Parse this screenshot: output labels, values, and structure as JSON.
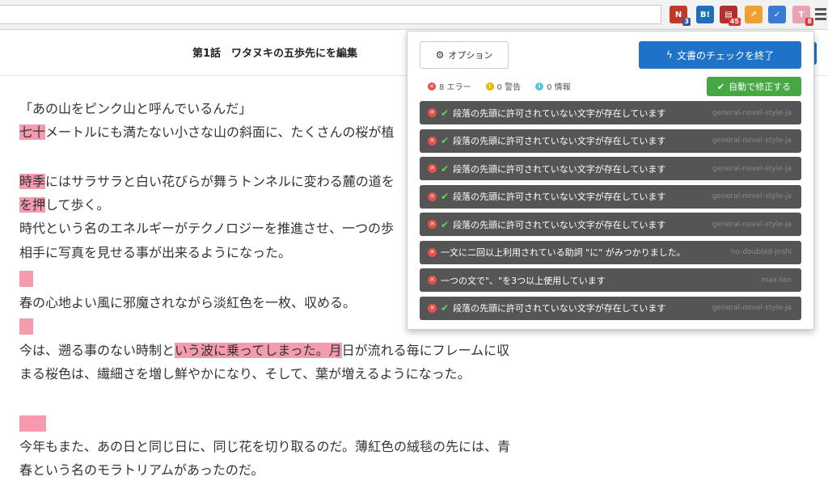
{
  "browser": {
    "extensions": [
      {
        "name": "n-extension",
        "label": "N",
        "badge": "3",
        "color": "#c0392b",
        "badge_color": "#3b5998"
      },
      {
        "name": "hatebu-extension",
        "label": "B!",
        "badge": "",
        "color": "#1d6fb8",
        "badge_color": "#888"
      },
      {
        "name": "calendar-extension",
        "label": "▤",
        "badge": "45",
        "color": "#b03030",
        "badge_color": "#d33"
      },
      {
        "name": "analytics-extension",
        "label": "↗",
        "badge": "",
        "color": "#f0a030",
        "badge_color": "#888"
      },
      {
        "name": "check-extension",
        "label": "✓",
        "badge": "",
        "color": "#3a7bd5",
        "badge_color": "#888"
      },
      {
        "name": "textlint-extension",
        "label": "T",
        "badge": "8",
        "color": "#e9a3b3",
        "badge_color": "#d33"
      }
    ]
  },
  "page": {
    "title": "第1話　ワタヌキの五歩先にを編集"
  },
  "editor": {
    "line1": "「あの山をピンク山と呼んでいるんだ」",
    "line2_hl": "七十",
    "line2_rest": "メートルにも満たない小さな山の斜面に、たくさんの桜が植",
    "line3_hl": "時季",
    "line3_rest": "にはサラサラと白い花びらが舞うトンネルに変わる麓の道を",
    "line4_hl": "を押",
    "line4_rest": "して歩く。",
    "line5": "時代という名のエネルギーがテクノロジーを推進させ、一つの歩",
    "line6": "相手に写真を見せる事が出来るようになった。",
    "line7": "春の心地よい風に邪魔されながら淡紅色を一枚、収める。",
    "line8_pre": "今は、遡る事のない時制と",
    "line8_hl": "いう波に乗ってしまった。月",
    "line8_rest": "日が流れる毎にフレームに収",
    "line9": "まる桜色は、繊細さを増し鮮やかになり、そして、葉が増えるようになった。",
    "line10": "今年もまた、あの日と同じ日に、同じ花を切り取るのだ。薄紅色の絨毯の先には、青",
    "line11": "春という名のモラトリアムがあったのだ。"
  },
  "popup": {
    "options_label": "オプション",
    "finish_label": "文書のチェックを終了",
    "errors_label": "8 エラー",
    "warnings_label": "0 警告",
    "info_label": "0 情報",
    "autofix_label": "自動で修正する",
    "colors": {
      "primary": "#1e73c8",
      "success": "#45a845",
      "error": "#e8504a",
      "warning": "#e6b800",
      "info": "#5bc0de"
    },
    "errors": [
      {
        "message": "段落の先頭に許可されていない文字が存在しています",
        "rule": "general-novel-style-ja",
        "fixable": true
      },
      {
        "message": "段落の先頭に許可されていない文字が存在しています",
        "rule": "general-novel-style-ja",
        "fixable": true
      },
      {
        "message": "段落の先頭に許可されていない文字が存在しています",
        "rule": "general-novel-style-ja",
        "fixable": true
      },
      {
        "message": "段落の先頭に許可されていない文字が存在しています",
        "rule": "general-novel-style-ja",
        "fixable": true
      },
      {
        "message": "段落の先頭に許可されていない文字が存在しています",
        "rule": "general-novel-style-ja",
        "fixable": true
      },
      {
        "message": "一文に二回以上利用されている助詞 \"に\" がみつかりました。",
        "rule": "no-doubled-joshi",
        "fixable": false
      },
      {
        "message": "一つの文で\"、\"を3つ以上使用しています",
        "rule": "max-ten",
        "fixable": false
      },
      {
        "message": "段落の先頭に許可されていない文字が存在しています",
        "rule": "general-novel-style-ja",
        "fixable": true
      }
    ]
  }
}
